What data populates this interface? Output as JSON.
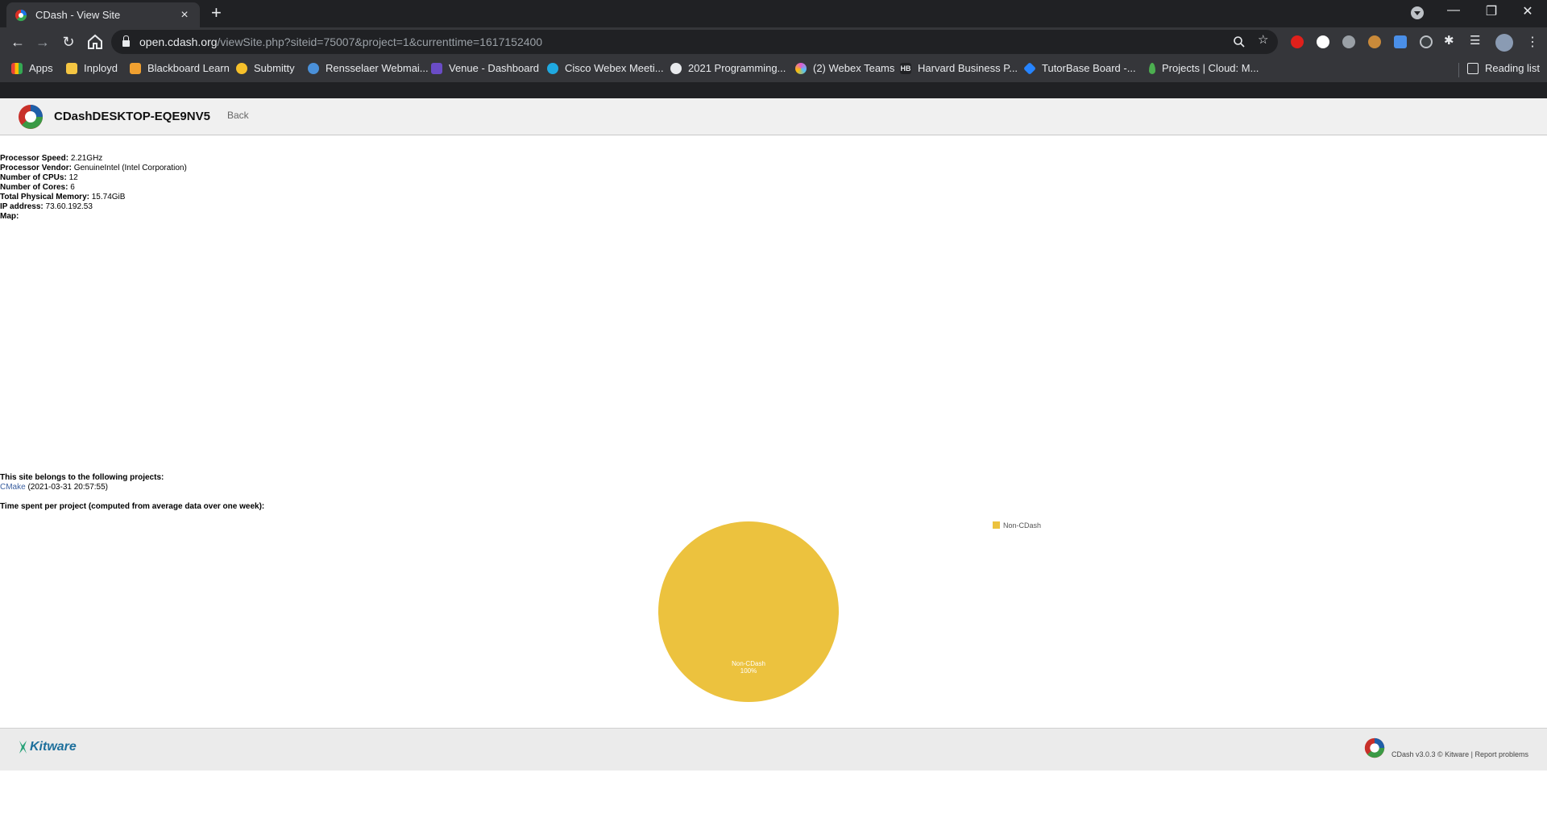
{
  "browser": {
    "tab_title": "CDash - View Site",
    "tab_close": "×",
    "new_tab": "+",
    "url_host": "open.cdash.org",
    "url_path": "/viewSite.php?siteid=75007&project=1&currenttime=1617152400",
    "bookmarks": [
      {
        "label": "Apps",
        "icon": "apps-grid-icon",
        "color": "#e8b339"
      },
      {
        "label": "Inployd",
        "icon": "bookmark-icon",
        "color": "#f4c542"
      },
      {
        "label": "Blackboard Learn",
        "icon": "blackboard-icon",
        "color": "#f0a030"
      },
      {
        "label": "Submitty",
        "icon": "duck-icon",
        "color": "#f6c02a"
      },
      {
        "label": "Rensselaer Webmai...",
        "icon": "mail-icon",
        "color": "#4a90d9"
      },
      {
        "label": "Venue - Dashboard",
        "icon": "venue-icon",
        "color": "#6a4cc6"
      },
      {
        "label": "Cisco Webex Meeti...",
        "icon": "webex-icon",
        "color": "#1fa9e1"
      },
      {
        "label": "2021 Programming...",
        "icon": "github-icon",
        "color": "#e8eaed"
      },
      {
        "label": "(2) Webex Teams",
        "icon": "webex-teams-icon",
        "color": "#e05ad0"
      },
      {
        "label": "Harvard Business P...",
        "icon": "hb-icon",
        "color": "#e8eaed"
      },
      {
        "label": "TutorBase Board -...",
        "icon": "jira-icon",
        "color": "#2684ff"
      },
      {
        "label": "Projects | Cloud: M...",
        "icon": "leaf-icon",
        "color": "#4caf50"
      }
    ],
    "reading_list": "Reading list"
  },
  "header": {
    "site_title": "CDashDESKTOP-EQE9NV5",
    "back_label": "Back"
  },
  "site_info": [
    {
      "label": "Processor Speed:",
      "value": "2.21GHz"
    },
    {
      "label": "Processor Vendor:",
      "value": "GenuineIntel (Intel Corporation)"
    },
    {
      "label": "Number of CPUs:",
      "value": "12"
    },
    {
      "label": "Number of Cores:",
      "value": "6"
    },
    {
      "label": "Total Physical Memory:",
      "value": "15.74GiB"
    },
    {
      "label": "IP address:",
      "value": "73.60.192.53"
    },
    {
      "label": "Map:",
      "value": ""
    }
  ],
  "projects": {
    "heading": "This site belongs to the following projects:",
    "items": [
      {
        "name": "CMake",
        "date": "(2021-03-31 20:57:55)"
      }
    ],
    "time_heading": "Time spent per project (computed from average data over one week):"
  },
  "chart_data": {
    "type": "pie",
    "slices": [
      {
        "label": "Non-CDash",
        "value": 100,
        "value_label": "100%",
        "color": "#ecc23e"
      }
    ],
    "legend": "top-right"
  },
  "footer": {
    "kitware_label": "Kitware",
    "version_text": "CDash v3.0.3 © Kitware | Report problems"
  },
  "colors": {
    "pie_fill": "#ecc23e",
    "link": "#3a5fa0"
  }
}
